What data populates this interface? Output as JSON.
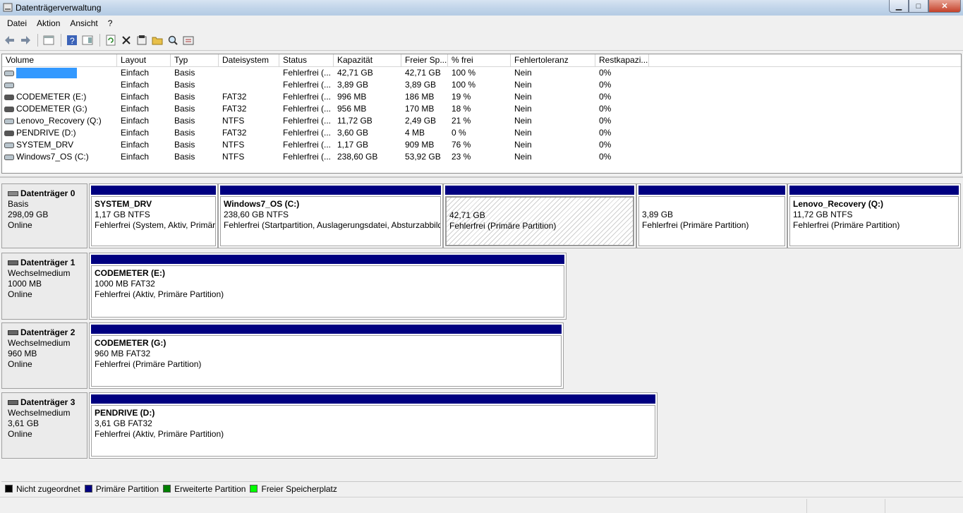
{
  "window": {
    "title": "Datenträgerverwaltung",
    "minimize": "▁",
    "maximize": "□",
    "close": "✕"
  },
  "menu": [
    "Datei",
    "Aktion",
    "Ansicht",
    "?"
  ],
  "toolbar": [
    "back-icon",
    "forward-icon",
    "console-icon",
    "help-icon",
    "properties-panel-icon",
    "refresh-icon",
    "delete-icon",
    "properties-icon",
    "open-folder-icon",
    "search-icon",
    "settings-icon"
  ],
  "columns": [
    "Volume",
    "Layout",
    "Typ",
    "Dateisystem",
    "Status",
    "Kapazität",
    "Freier Sp...",
    "% frei",
    "Fehlertoleranz",
    "Restkapazi..."
  ],
  "volumes": [
    {
      "name": "",
      "layout": "Einfach",
      "type": "Basis",
      "fs": "",
      "status": "Fehlerfrei (...",
      "capacity": "42,71 GB",
      "free": "42,71 GB",
      "pct": "100 %",
      "fault": "Nein",
      "overhead": "0%",
      "selected": true
    },
    {
      "name": "",
      "layout": "Einfach",
      "type": "Basis",
      "fs": "",
      "status": "Fehlerfrei (...",
      "capacity": "3,89 GB",
      "free": "3,89 GB",
      "pct": "100 %",
      "fault": "Nein",
      "overhead": "0%"
    },
    {
      "name": "CODEMETER (E:)",
      "layout": "Einfach",
      "type": "Basis",
      "fs": "FAT32",
      "status": "Fehlerfrei (...",
      "capacity": "996 MB",
      "free": "186 MB",
      "pct": "19 %",
      "fault": "Nein",
      "overhead": "0%"
    },
    {
      "name": "CODEMETER (G:)",
      "layout": "Einfach",
      "type": "Basis",
      "fs": "FAT32",
      "status": "Fehlerfrei (...",
      "capacity": "956 MB",
      "free": "170 MB",
      "pct": "18 %",
      "fault": "Nein",
      "overhead": "0%"
    },
    {
      "name": "Lenovo_Recovery (Q:)",
      "layout": "Einfach",
      "type": "Basis",
      "fs": "NTFS",
      "status": "Fehlerfrei (...",
      "capacity": "11,72 GB",
      "free": "2,49 GB",
      "pct": "21 %",
      "fault": "Nein",
      "overhead": "0%"
    },
    {
      "name": "PENDRIVE (D:)",
      "layout": "Einfach",
      "type": "Basis",
      "fs": "FAT32",
      "status": "Fehlerfrei (...",
      "capacity": "3,60 GB",
      "free": "4 MB",
      "pct": "0 %",
      "fault": "Nein",
      "overhead": "0%"
    },
    {
      "name": "SYSTEM_DRV",
      "layout": "Einfach",
      "type": "Basis",
      "fs": "NTFS",
      "status": "Fehlerfrei (...",
      "capacity": "1,17 GB",
      "free": "909 MB",
      "pct": "76 %",
      "fault": "Nein",
      "overhead": "0%"
    },
    {
      "name": "Windows7_OS (C:)",
      "layout": "Einfach",
      "type": "Basis",
      "fs": "NTFS",
      "status": "Fehlerfrei (...",
      "capacity": "238,60 GB",
      "free": "53,92 GB",
      "pct": "23 %",
      "fault": "Nein",
      "overhead": "0%"
    }
  ],
  "disks": [
    {
      "name": "Datenträger 0",
      "kind": "Basis",
      "size": "298,09 GB",
      "state": "Online",
      "partitions": [
        {
          "name": "SYSTEM_DRV",
          "size": "1,17 GB NTFS",
          "status": "Fehlerfrei (System, Aktiv, Primär"
        },
        {
          "name": "Windows7_OS  (C:)",
          "size": "238,60 GB NTFS",
          "status": "Fehlerfrei (Startpartition, Auslagerungsdatei, Absturzabbild"
        },
        {
          "name": "",
          "size": "42,71 GB",
          "status": "Fehlerfrei (Primäre Partition)"
        },
        {
          "name": "",
          "size": "3,89 GB",
          "status": "Fehlerfrei (Primäre Partition)"
        },
        {
          "name": "Lenovo_Recovery  (Q:)",
          "size": "11,72 GB NTFS",
          "status": "Fehlerfrei (Primäre Partition)"
        }
      ]
    },
    {
      "name": "Datenträger 1",
      "kind": "Wechselmedium",
      "size": "1000 MB",
      "state": "Online",
      "partitions": [
        {
          "name": "CODEMETER  (E:)",
          "size": "1000 MB FAT32",
          "status": "Fehlerfrei (Aktiv, Primäre Partition)"
        }
      ]
    },
    {
      "name": "Datenträger 2",
      "kind": "Wechselmedium",
      "size": "960 MB",
      "state": "Online",
      "partitions": [
        {
          "name": "CODEMETER  (G:)",
          "size": "960 MB FAT32",
          "status": "Fehlerfrei (Primäre Partition)"
        }
      ]
    },
    {
      "name": "Datenträger 3",
      "kind": "Wechselmedium",
      "size": "3,61 GB",
      "state": "Online",
      "partitions": [
        {
          "name": "PENDRIVE  (D:)",
          "size": "3,61 GB FAT32",
          "status": "Fehlerfrei (Aktiv, Primäre Partition)"
        }
      ]
    }
  ],
  "legend": [
    {
      "label": "Nicht zugeordnet",
      "color": "#000000"
    },
    {
      "label": "Primäre Partition",
      "color": "#000080"
    },
    {
      "label": "Erweiterte Partition",
      "color": "#008000"
    },
    {
      "label": "Freier Speicherplatz",
      "color": "#00ff00"
    }
  ]
}
